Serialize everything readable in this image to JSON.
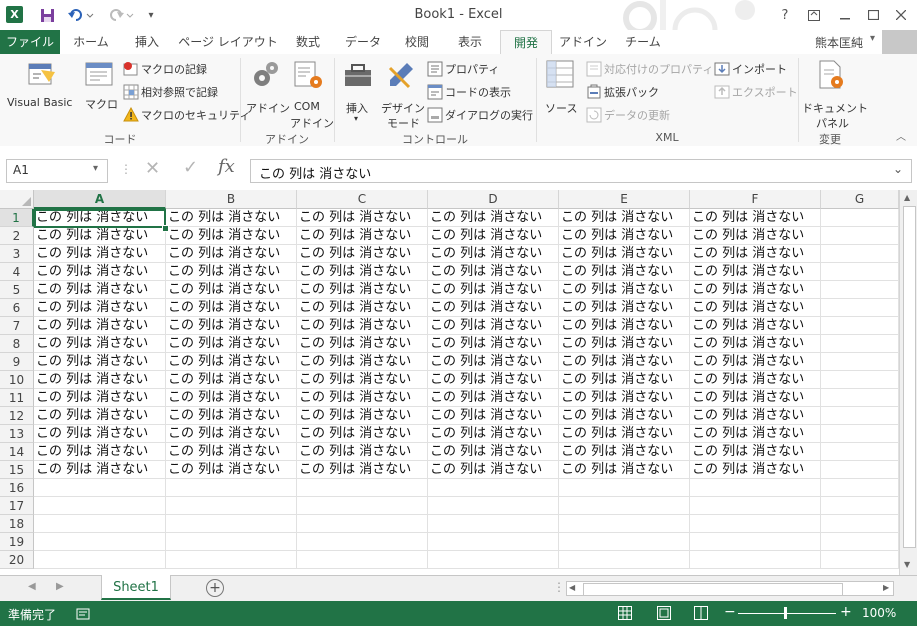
{
  "window": {
    "title": "Book1 - Excel",
    "help_label": "?",
    "user_name": "熊本匡純"
  },
  "tabs": [
    "ファイル",
    "ホーム",
    "挿入",
    "ページ レイアウト",
    "数式",
    "データ",
    "校閲",
    "表示",
    "開発",
    "アドイン",
    "チーム"
  ],
  "active_tab": "開発",
  "ribbon": {
    "code": {
      "label": "コード",
      "visual_basic": "Visual Basic",
      "macro": "マクロ",
      "record_macro": "マクロの記録",
      "relative_ref": "相対参照で記録",
      "macro_security": "マクロのセキュリティ"
    },
    "addins": {
      "label": "アドイン",
      "addin": "アドイン",
      "com_line1": "COM",
      "com_line2": "アドイン"
    },
    "controls": {
      "label": "コントロール",
      "insert": "挿入",
      "design_line1": "デザイン",
      "design_line2": "モード",
      "properties": "プロパティ",
      "view_code": "コードの表示",
      "run_dialog": "ダイアログの実行"
    },
    "xml": {
      "label": "XML",
      "source": "ソース",
      "map_props": "対応付けのプロパティ",
      "expansion": "拡張パック",
      "refresh": "データの更新",
      "import": "インポート",
      "export": "エクスポート"
    },
    "modify": {
      "label": "変更",
      "docpanel_line1": "ドキュメント",
      "docpanel_line2": "パネル"
    }
  },
  "formula_bar": {
    "name_box": "A1",
    "cancel": "✕",
    "enter": "✓",
    "fx": "fx",
    "content": "この 列は 消さない"
  },
  "sheet": {
    "columns": [
      "A",
      "B",
      "C",
      "D",
      "E",
      "F",
      "G"
    ],
    "selected_column": "A",
    "selected_row": 1,
    "rows": 20,
    "filled_rows": 15,
    "filled_columns": 6,
    "cell_text": "この 列は 消さない"
  },
  "sheet_tabs": [
    "Sheet1"
  ],
  "add_sheet": "+",
  "status": {
    "ready": "準備完了",
    "zoom": "100%",
    "zoom_minus": "−",
    "zoom_plus": "+"
  },
  "colors": {
    "excel_green": "#217346",
    "tab_active_text": "#217346"
  }
}
